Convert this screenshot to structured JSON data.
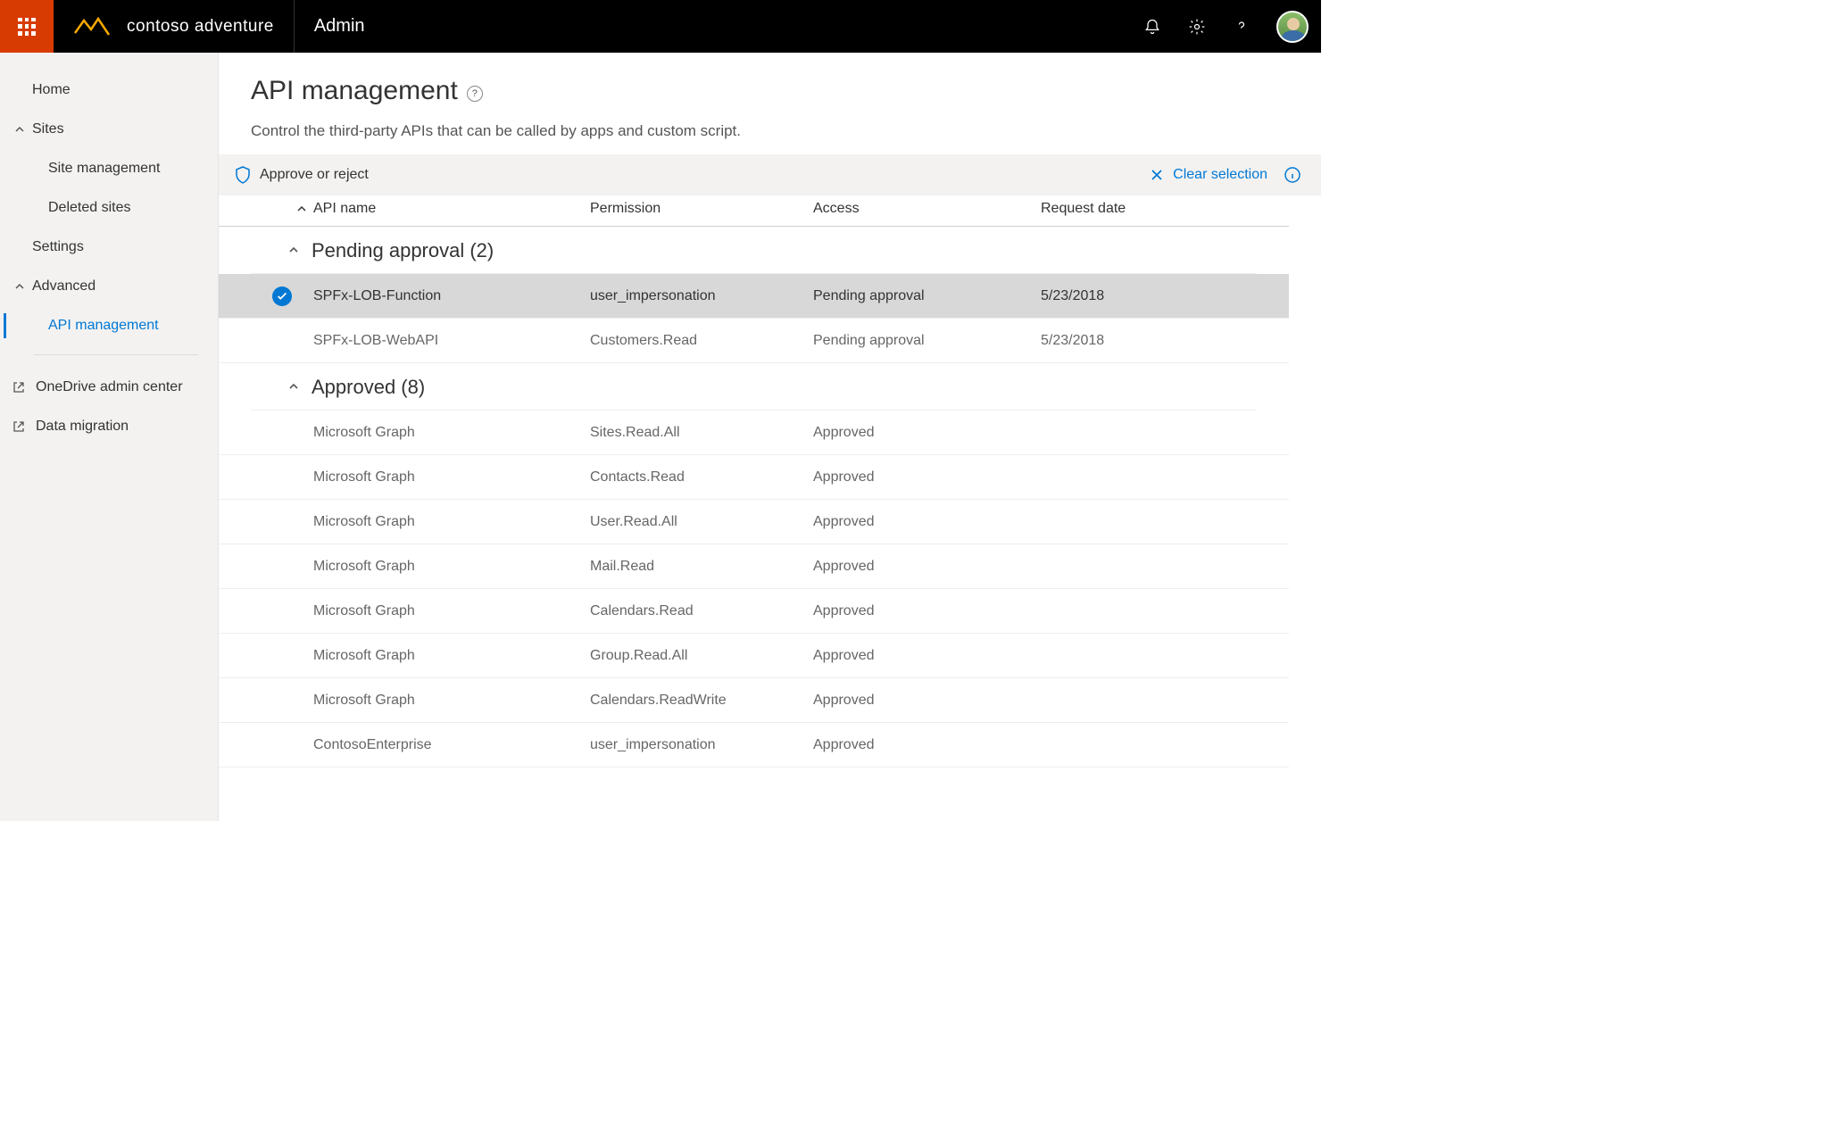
{
  "topbar": {
    "brand": "contoso adventure",
    "app_title": "Admin"
  },
  "sidebar": {
    "home": "Home",
    "sites": "Sites",
    "site_management": "Site management",
    "deleted_sites": "Deleted sites",
    "settings": "Settings",
    "advanced": "Advanced",
    "api_management": "API management",
    "onedrive": "OneDrive admin center",
    "data_migration": "Data migration"
  },
  "page": {
    "title": "API management",
    "description": "Control the third-party APIs that can be called by apps and custom script."
  },
  "cmdbar": {
    "approve_reject": "Approve or reject",
    "clear_selection": "Clear selection"
  },
  "columns": {
    "api_name": "API name",
    "permission": "Permission",
    "access": "Access",
    "request_date": "Request date"
  },
  "groups": {
    "pending": {
      "title": "Pending approval (2)",
      "rows": [
        {
          "api": "SPFx-LOB-Function",
          "permission": "user_impersonation",
          "access": "Pending approval",
          "date": "5/23/2018",
          "selected": true
        },
        {
          "api": "SPFx-LOB-WebAPI",
          "permission": "Customers.Read",
          "access": "Pending approval",
          "date": "5/23/2018",
          "selected": false
        }
      ]
    },
    "approved": {
      "title": "Approved (8)",
      "rows": [
        {
          "api": "Microsoft Graph",
          "permission": "Sites.Read.All",
          "access": "Approved",
          "date": ""
        },
        {
          "api": "Microsoft Graph",
          "permission": "Contacts.Read",
          "access": "Approved",
          "date": ""
        },
        {
          "api": "Microsoft Graph",
          "permission": "User.Read.All",
          "access": "Approved",
          "date": ""
        },
        {
          "api": "Microsoft Graph",
          "permission": "Mail.Read",
          "access": "Approved",
          "date": ""
        },
        {
          "api": "Microsoft Graph",
          "permission": "Calendars.Read",
          "access": "Approved",
          "date": ""
        },
        {
          "api": "Microsoft Graph",
          "permission": "Group.Read.All",
          "access": "Approved",
          "date": ""
        },
        {
          "api": "Microsoft Graph",
          "permission": "Calendars.ReadWrite",
          "access": "Approved",
          "date": ""
        },
        {
          "api": "ContosoEnterprise",
          "permission": "user_impersonation",
          "access": "Approved",
          "date": ""
        }
      ]
    }
  }
}
